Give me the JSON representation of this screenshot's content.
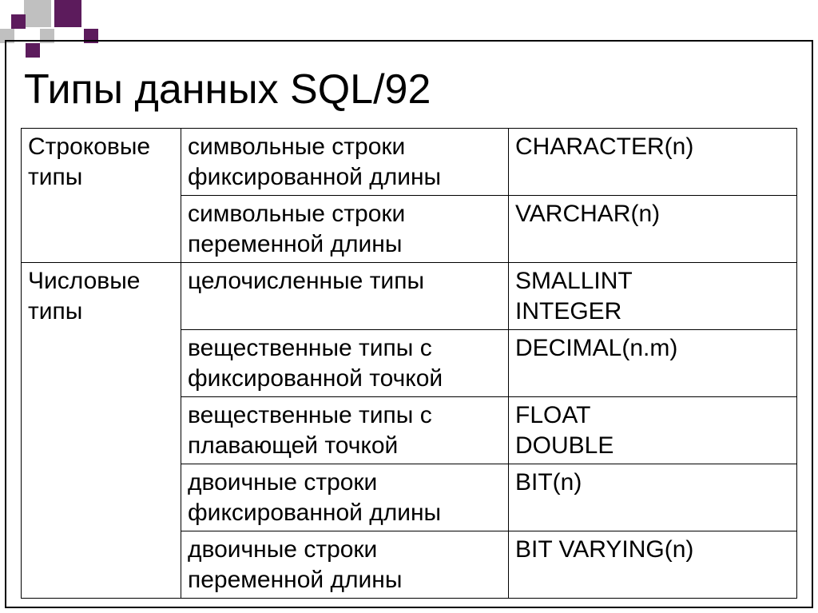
{
  "title": "Типы данных SQL/92",
  "rows": [
    {
      "cat": "Строковые типы",
      "desc": "символьные строки фиксированной длины",
      "type": "CHARACTER(n)",
      "catRowspan": 2
    },
    {
      "desc": "символьные строки переменной длины",
      "type": "VARCHAR(n)"
    },
    {
      "cat": "Числовые типы",
      "desc": "целочисленные типы",
      "typeLines": [
        "SMALLINT",
        "INTEGER"
      ],
      "catRowspan": 5
    },
    {
      "desc": "вещественные типы с фиксированной точкой",
      "type": "DECIMAL(n.m)"
    },
    {
      "desc": "вещественные типы с плавающей точкой",
      "typeLines": [
        "FLOAT",
        "DOUBLE"
      ]
    },
    {
      "desc": "двоичные строки фиксированной длины",
      "type": "BIT(n)"
    },
    {
      "desc": "двоичные строки переменной длины",
      "type": "BIT VARYING(n)"
    }
  ]
}
